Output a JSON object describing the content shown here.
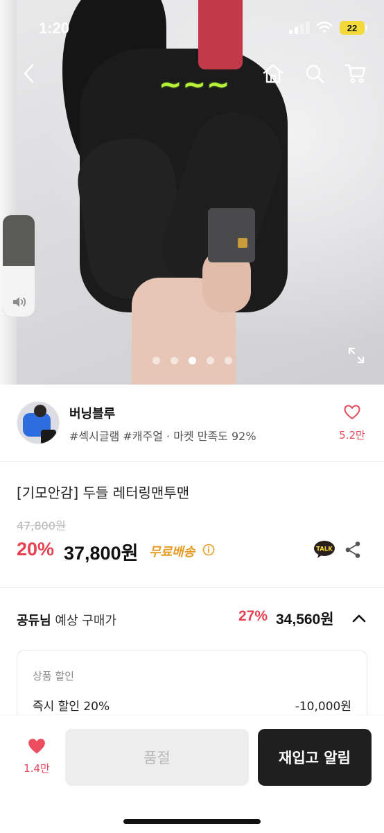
{
  "status_bar": {
    "time": "1:20",
    "battery": "22"
  },
  "icons": {
    "back": "chevron-left-icon",
    "home": "home-icon",
    "search": "search-icon",
    "cart": "cart-icon",
    "volume": "speaker-icon",
    "expand": "expand-icon",
    "heart": "heart-icon",
    "info": "info-icon",
    "talk": "kakao-talk-icon",
    "share": "share-icon",
    "chevron_up": "chevron-up-icon"
  },
  "colors": {
    "accent": "#e84152",
    "shipping": "#e69c23",
    "cta_dark": "#1f1f1f",
    "disabled": "#ededed"
  },
  "hero": {
    "slide_count": 5,
    "active_slide": 3,
    "volume_level": 0.5
  },
  "seller": {
    "name": "버닝블루",
    "tags": "#섹시글램 #캐주얼 · 마켓 만족도 92%",
    "likes": "5.2만"
  },
  "product": {
    "title": "[기모안감] 두들 레터링맨투맨",
    "original_price": "47,800원",
    "discount_rate": "20%",
    "price": "37,800원",
    "shipping": "무료배송",
    "talk_label": "TALK"
  },
  "estimate": {
    "user": "공듀님",
    "label": "예상 구매가",
    "rate": "27%",
    "price": "34,560원"
  },
  "discount_card": {
    "title": "상품 할인",
    "item_label": "즉시 할인 20%",
    "item_value": "-10,000원"
  },
  "bottom_bar": {
    "likes": "1.4만",
    "soldout_label": "품절",
    "restock_label": "재입고 알림"
  }
}
